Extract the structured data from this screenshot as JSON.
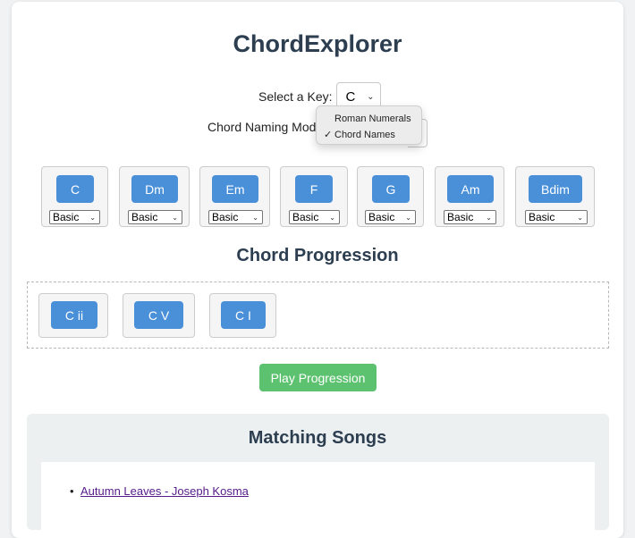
{
  "app": {
    "title": "ChordExplorer"
  },
  "key_select": {
    "label": "Select a Key:",
    "value": "C"
  },
  "naming_mode": {
    "label": "Chord Naming Mode",
    "options": [
      {
        "label": "Roman Numerals",
        "checked": false
      },
      {
        "label": "Chord Names",
        "checked": true
      }
    ],
    "check_glyph": "✓"
  },
  "chords": [
    {
      "name": "C",
      "variant": "Basic"
    },
    {
      "name": "Dm",
      "variant": "Basic"
    },
    {
      "name": "Em",
      "variant": "Basic"
    },
    {
      "name": "F",
      "variant": "Basic"
    },
    {
      "name": "G",
      "variant": "Basic"
    },
    {
      "name": "Am",
      "variant": "Basic"
    },
    {
      "name": "Bdim",
      "variant": "Basic"
    }
  ],
  "progression": {
    "title": "Chord Progression",
    "items": [
      "C ii",
      "C V",
      "C I"
    ],
    "play_label": "Play Progression"
  },
  "songs": {
    "title": "Matching Songs",
    "items": [
      "Autumn Leaves - Joseph Kosma"
    ],
    "bullet": "•"
  },
  "colors": {
    "chord_button": "#4a90d9",
    "play_button": "#5dc26f",
    "heading": "#2c3e50",
    "link": "#551a8b"
  }
}
